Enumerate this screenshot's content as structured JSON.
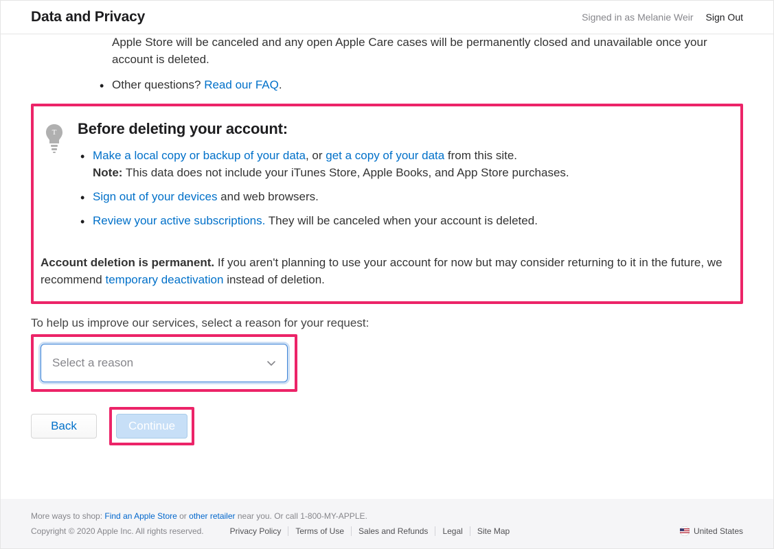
{
  "header": {
    "title": "Data and Privacy",
    "signed_in_prefix": "Signed in as ",
    "user_name": "Melanie Weir",
    "sign_out": "Sign Out"
  },
  "partial_bullets": {
    "first_fragment": "Apple Store will be canceled and any open Apple Care cases will be permanently closed and unavailable once your account is deleted.",
    "other_questions_text": "Other questions? ",
    "faq_link": "Read our FAQ",
    "faq_period": "."
  },
  "before": {
    "heading": "Before deleting your account:",
    "items": [
      {
        "link1": "Make a local copy or backup of your data",
        "mid1": ", or ",
        "link2": "get a copy of your data",
        "tail": " from this site.",
        "note_label": "Note:",
        "note_text": " This data does not include your iTunes Store, Apple Books, and App Store purchases."
      },
      {
        "link1": "Sign out of your devices",
        "tail": " and web browsers."
      },
      {
        "link1": "Review your active subscriptions.",
        "tail": " They will be canceled when your account is deleted."
      }
    ]
  },
  "permanent": {
    "label": "Account deletion is permanent.",
    "text": " If you aren't planning to use your account for now but may consider returning to it in the future, we recommend ",
    "link": "temporary deactivation",
    "tail": " instead of deletion."
  },
  "reason": {
    "label": "To help us improve our services, select a reason for your request:",
    "placeholder": "Select a reason"
  },
  "buttons": {
    "back": "Back",
    "continue": "Continue"
  },
  "footer": {
    "more_ways_prefix": "More ways to shop: ",
    "find_store": "Find an Apple Store",
    "or": " or ",
    "other_retailer": "other retailer",
    "near_you": " near you. Or call 1-800-MY-APPLE.",
    "copyright": "Copyright © 2020 Apple Inc. All rights reserved.",
    "links": [
      "Privacy Policy",
      "Terms of Use",
      "Sales and Refunds",
      "Legal",
      "Site Map"
    ],
    "region": "United States"
  }
}
